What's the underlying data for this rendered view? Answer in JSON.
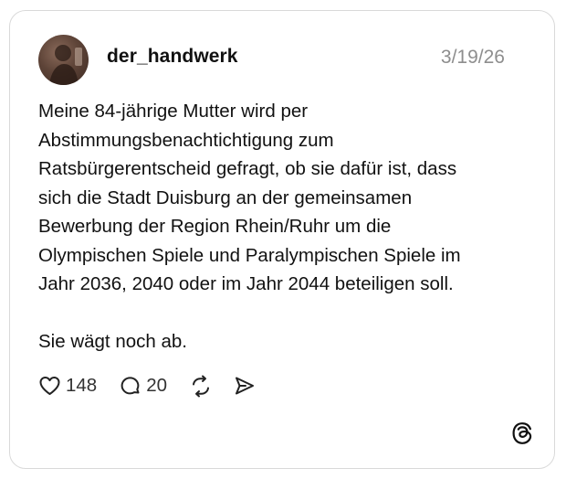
{
  "post": {
    "username": "der_handwerk",
    "date": "3/19/26",
    "text_lines": [
      "Meine 84-jährige Mutter wird per",
      "Abstimmungsbenachtichtigung zum",
      "Ratsbürgerentscheid gefragt, ob sie dafür ist, dass",
      "sich die Stadt Duisburg an der gemeinsamen",
      "Bewerbung der Region Rhein/Ruhr um die",
      "Olympischen Spiele und Paralympischen Spiele im",
      "Jahr 2036, 2040 oder im Jahr 2044 beteiligen soll."
    ],
    "text_followup": "Sie wägt noch ab.",
    "likes": "148",
    "replies": "20"
  },
  "icons": {
    "like": "heart-icon",
    "reply": "speech-bubble-icon",
    "repost": "repost-icon",
    "share": "send-icon",
    "brand": "threads-logo-icon"
  },
  "colors": {
    "text": "#111111",
    "muted": "#8e8e8e",
    "border": "#d9d9d9"
  }
}
